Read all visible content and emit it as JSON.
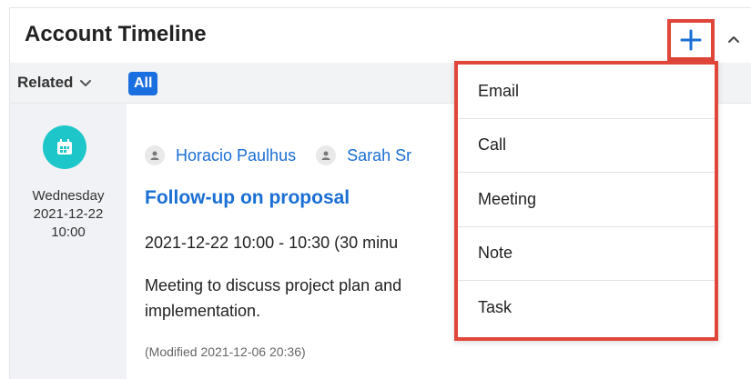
{
  "header": {
    "title": "Account Timeline",
    "add_icon": "plus-icon",
    "collapse_icon": "chevron-up-icon"
  },
  "filters": {
    "related_label": "Related",
    "related_icon": "chevron-down-icon",
    "all_label": "All"
  },
  "event": {
    "icon": "calendar-icon",
    "date_day": "Wednesday",
    "date": "2021-12-22",
    "time": "10:00",
    "people": [
      {
        "name": "Horacio Paulhus"
      },
      {
        "name": "Sarah Sr"
      }
    ],
    "subject": "Follow-up on proposal",
    "time_range": "2021-12-22 10:00 - 10:30 (30 minu",
    "description": "Meeting to discuss project plan and implementation.",
    "modified": "(Modified 2021-12-06 20:36)"
  },
  "add_menu": {
    "items": [
      "Email",
      "Call",
      "Meeting",
      "Note",
      "Task"
    ]
  },
  "colors": {
    "accent_blue": "#1a6fd4",
    "pill_blue": "#1a6fe0",
    "highlight_red": "#e0463a",
    "calendar_teal": "#1dc6c9"
  }
}
